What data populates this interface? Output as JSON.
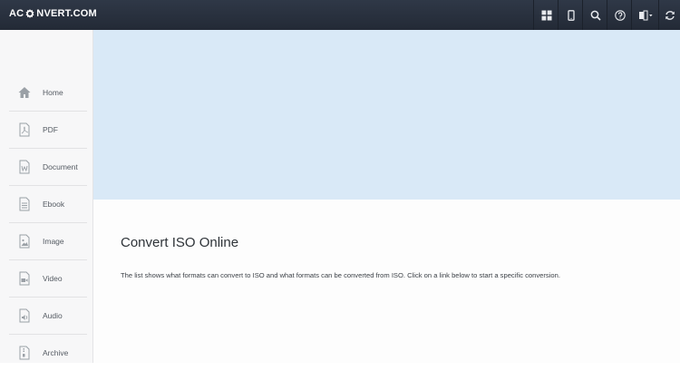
{
  "header": {
    "logo_left": "AC",
    "logo_right": "NVERT.COM",
    "buttons": [
      {
        "icon": "grid-icon"
      },
      {
        "icon": "mobile-icon"
      },
      {
        "icon": "search-icon"
      },
      {
        "icon": "help-icon"
      },
      {
        "icon": "language-icon"
      },
      {
        "icon": "refresh-icon"
      }
    ]
  },
  "sidebar": {
    "items": [
      {
        "label": "Home",
        "icon": "home-icon"
      },
      {
        "label": "PDF",
        "icon": "pdf-icon"
      },
      {
        "label": "Document",
        "icon": "document-icon"
      },
      {
        "label": "Ebook",
        "icon": "ebook-icon"
      },
      {
        "label": "Image",
        "icon": "image-icon"
      },
      {
        "label": "Video",
        "icon": "video-icon"
      },
      {
        "label": "Audio",
        "icon": "audio-icon"
      },
      {
        "label": "Archive",
        "icon": "archive-icon"
      }
    ]
  },
  "main": {
    "title": "Convert ISO Online",
    "description": "The list shows what formats can convert to ISO and what formats can be converted from ISO. Click on a link below to start a specific conversion."
  },
  "colors": {
    "topbar": "#2a323f",
    "banner": "#d9e9f7",
    "sidebar": "#f7f7f8"
  }
}
